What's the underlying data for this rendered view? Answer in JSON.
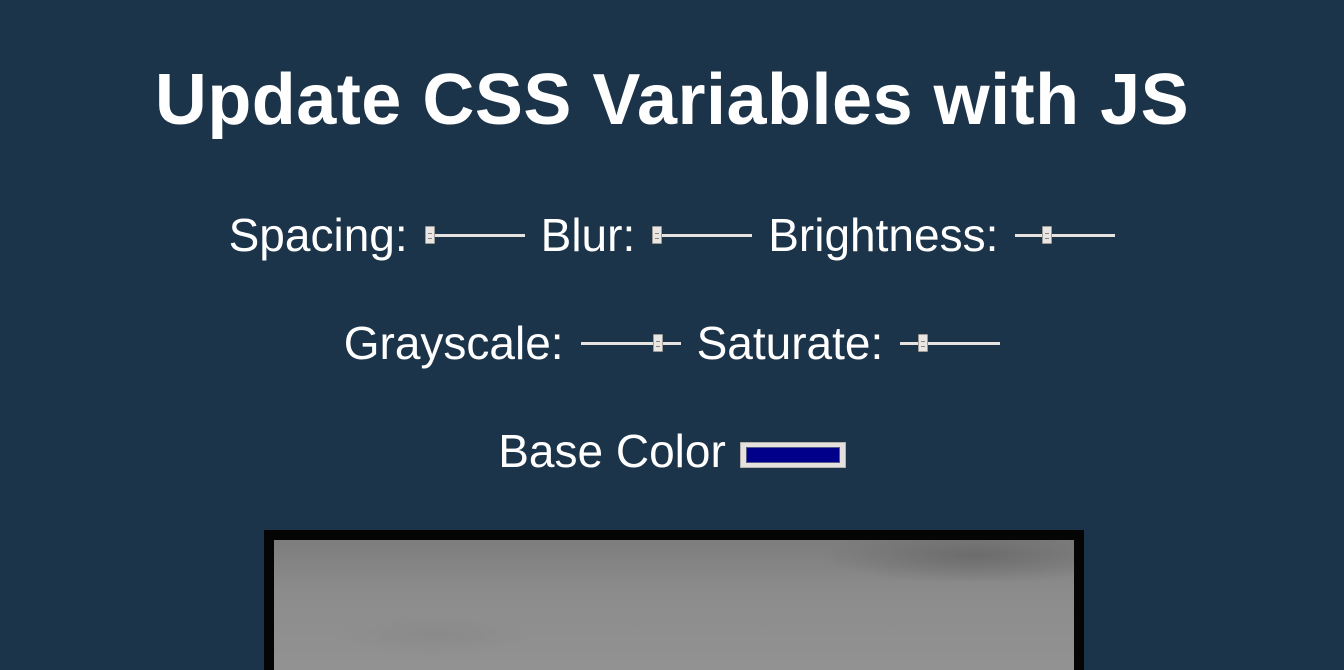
{
  "title": "Update CSS Variables with JS",
  "controls": {
    "spacing": {
      "label": "Spacing:",
      "value_fraction": 0.0
    },
    "blur": {
      "label": "Blur:",
      "value_fraction": 0.0
    },
    "brightness": {
      "label": "Brightness:",
      "value_fraction": 0.3
    },
    "grayscale": {
      "label": "Grayscale:",
      "value_fraction": 0.8
    },
    "saturate": {
      "label": "Saturate:",
      "value_fraction": 0.2
    },
    "base_color": {
      "label": "Base Color",
      "value": "#00008b"
    }
  },
  "colors": {
    "background": "#1c344a",
    "text": "#ffffff",
    "frame": "#050505"
  }
}
